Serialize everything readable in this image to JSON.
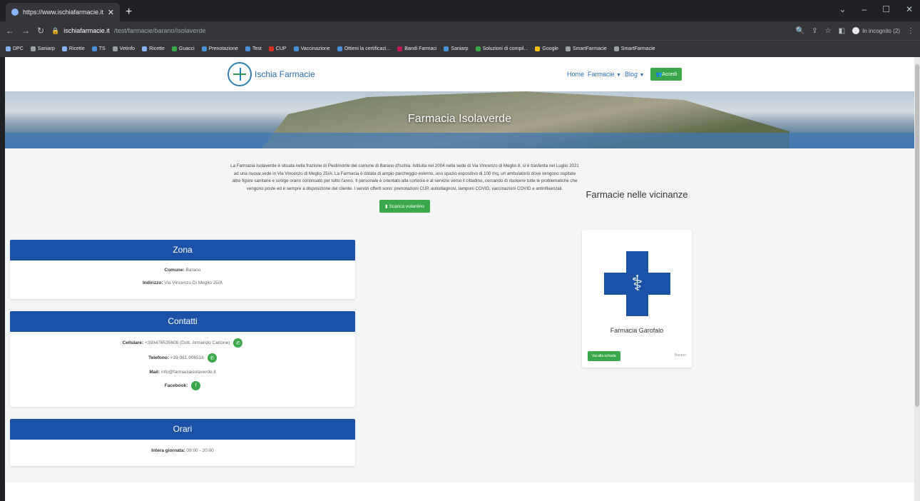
{
  "browser": {
    "tab_title": "https://www.ischiafarmacie.it/te",
    "url_host": "ischiafarmacie.it",
    "url_path": "/test/farmacie/barano/Isolaverde",
    "incognito_label": "In incognito (2)",
    "bookmarks": [
      "DPC",
      "Saniarp",
      "Ricette",
      "TS",
      "Vetinfo",
      "Ricette",
      "Guacci",
      "Prenotazione",
      "Test",
      "CUP",
      "Vaccinazione",
      "Ottieni la certificazi...",
      "Bandi Farmaci",
      "Saniarp",
      "Soluzioni di compil...",
      "Google",
      "SmartFarmacie",
      "SmartFarmacie"
    ]
  },
  "site": {
    "brand": "Ischia Farmacie",
    "nav": {
      "home": "Home",
      "farmacie": "Farmacie",
      "blog": "Blog",
      "login": "Accedi"
    }
  },
  "hero": {
    "title": "Farmacia Isolaverde"
  },
  "description": "La Farmacia Isolaverde è situata nella frazione di Piedimonte del comune di Barano d'Ischia. Istituita nel 2004 nella sede di Via Vincenzo di Meglio 8, si è trasferita nel Luglio 2021 ad una nuova sede in Via Vincenzo di Meglio 25/A. La Farmacia è dotata di ampio parcheggio esterno, uno spazio espositivo di 100 mq, un ambulatorio dove vengono ospitate altre figure sanitarie e svolge orario continuato per tutto l'anno. Il personale è orientato alla cortesia e al servizio verso il cittadino, cercando di risolvere tutte le problematiche che vengono poste ed è sempre a disposizione del cliente. I servizi offerti sono: prenotazioni CUP, autodiagnosi, tamponi COVID, vaccinazioni COVID e antinfluenzali.",
  "download_btn": "Scarica volantino",
  "zona": {
    "title": "Zona",
    "comune_label": "Comune:",
    "comune": "Barano",
    "indirizzo_label": "Indirizzo:",
    "indirizzo": "Via Vincenzo Di Meglio 25/A"
  },
  "contatti": {
    "title": "Contatti",
    "cell_label": "Cellulare:",
    "cell": "+393476535608 (Dott. Armando Carlone)",
    "tel_label": "Telefono:",
    "tel": "+39 081 906516",
    "mail_label": "Mail:",
    "mail": "info@farmaciaisolaverde.it",
    "fb_label": "Facebook:"
  },
  "orari": {
    "title": "Orari",
    "label": "Intera giornata:",
    "value": "09:00 - 20:00"
  },
  "sidebar": {
    "title": "Farmacie nelle vicinanze",
    "card": {
      "name": "Farmacia Garofalo",
      "button": "Vai alla scheda",
      "location": "Barano"
    }
  },
  "colors": {
    "primary": "#1c51a8",
    "success": "#3aa84a"
  }
}
